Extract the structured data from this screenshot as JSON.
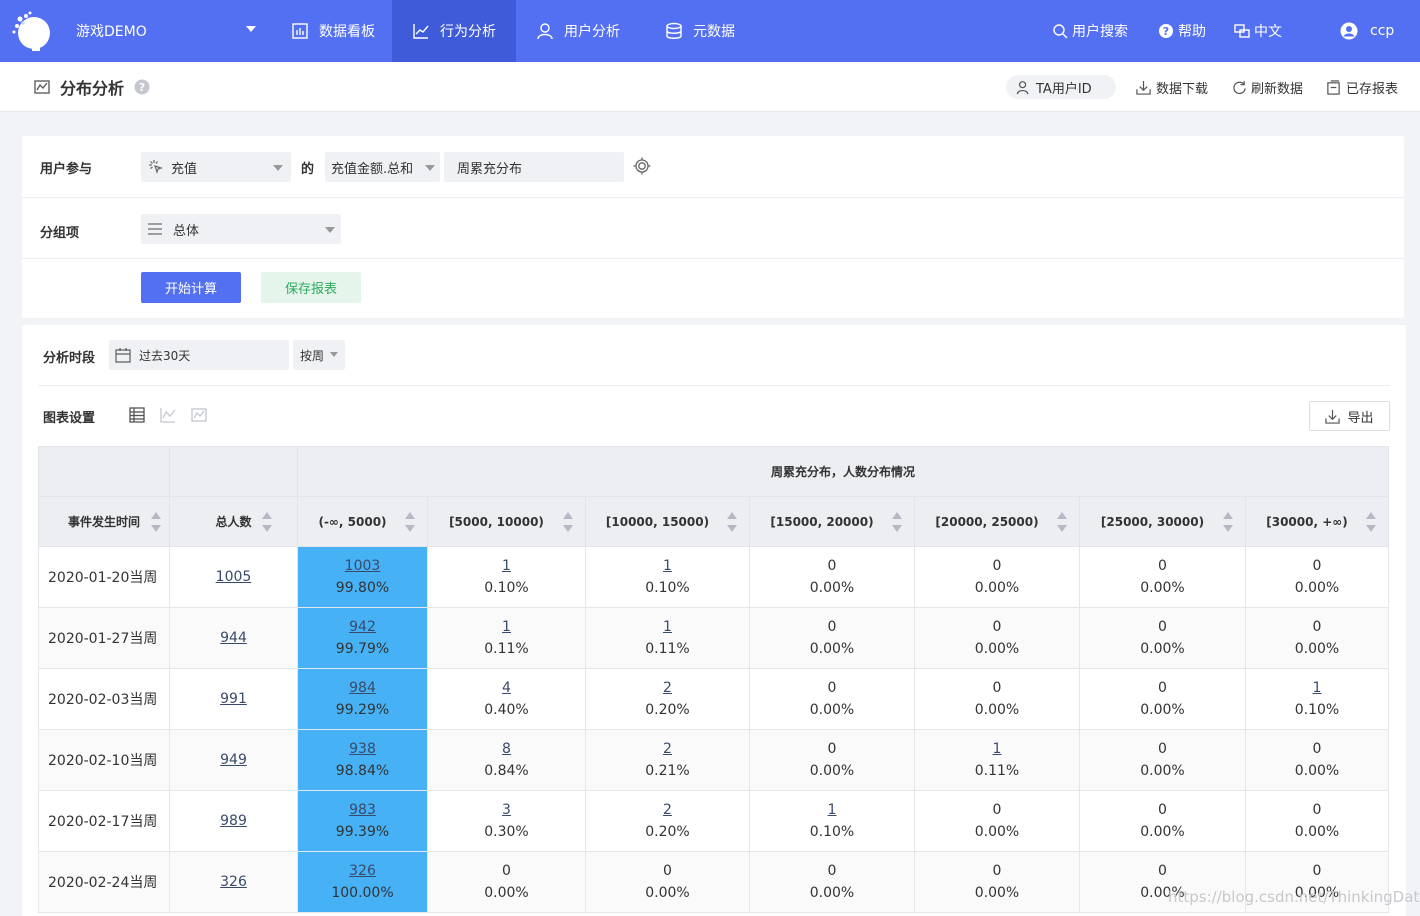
{
  "topnav": {
    "project": "游戏DEMO",
    "tabs": [
      {
        "label": "数据看板",
        "icon": "bar-chart-icon"
      },
      {
        "label": "行为分析",
        "icon": "line-chart-icon"
      },
      {
        "label": "用户分析",
        "icon": "user-icon"
      },
      {
        "label": "元数据",
        "icon": "database-icon"
      }
    ],
    "active_tab": "行为分析",
    "right": [
      {
        "label": "用户搜索",
        "icon": "search-icon"
      },
      {
        "label": "帮助",
        "icon": "help-icon"
      },
      {
        "label": "中文",
        "icon": "language-icon"
      },
      {
        "label": "ccp",
        "icon": "avatar-icon"
      }
    ],
    "colors": {
      "bar": "#5470f2",
      "active": "#3f5bd9"
    }
  },
  "subheader": {
    "title": "分布分析",
    "actions": [
      "TA用户ID",
      "数据下载",
      "刷新数据",
      "已存报表"
    ]
  },
  "query": {
    "participation_label": "用户参与",
    "event": "充值",
    "of_label": "的",
    "metric": "充值金额.总和",
    "distribution": "周累充分布",
    "group_label": "分组项",
    "group_value": "总体",
    "calc_button": "开始计算",
    "save_button": "保存报表"
  },
  "analysis": {
    "period_label": "分析时段",
    "period_value": "过去30天",
    "granularity": "按周",
    "chart_settings_label": "图表设置",
    "export_button": "导出"
  },
  "table": {
    "group_header": "周累充分布，人数分布情况",
    "col_date": "事件发生时间",
    "col_total": "总人数",
    "buckets": [
      "(-∞, 5000)",
      "[5000, 10000)",
      "[10000, 15000)",
      "[15000, 20000)",
      "[20000, 25000)",
      "[25000, 30000)",
      "[30000, +∞)"
    ],
    "highlight_color": "#47b1f5",
    "rows": [
      {
        "date": "2020-01-20当周",
        "total": "1005",
        "cells": [
          {
            "c": "1003",
            "p": "99.80%"
          },
          {
            "c": "1",
            "p": "0.10%"
          },
          {
            "c": "1",
            "p": "0.10%"
          },
          {
            "c": "0",
            "p": "0.00%"
          },
          {
            "c": "0",
            "p": "0.00%"
          },
          {
            "c": "0",
            "p": "0.00%"
          },
          {
            "c": "0",
            "p": "0.00%"
          }
        ]
      },
      {
        "date": "2020-01-27当周",
        "total": "944",
        "cells": [
          {
            "c": "942",
            "p": "99.79%"
          },
          {
            "c": "1",
            "p": "0.11%"
          },
          {
            "c": "1",
            "p": "0.11%"
          },
          {
            "c": "0",
            "p": "0.00%"
          },
          {
            "c": "0",
            "p": "0.00%"
          },
          {
            "c": "0",
            "p": "0.00%"
          },
          {
            "c": "0",
            "p": "0.00%"
          }
        ]
      },
      {
        "date": "2020-02-03当周",
        "total": "991",
        "cells": [
          {
            "c": "984",
            "p": "99.29%"
          },
          {
            "c": "4",
            "p": "0.40%"
          },
          {
            "c": "2",
            "p": "0.20%"
          },
          {
            "c": "0",
            "p": "0.00%"
          },
          {
            "c": "0",
            "p": "0.00%"
          },
          {
            "c": "0",
            "p": "0.00%"
          },
          {
            "c": "1",
            "p": "0.10%"
          }
        ]
      },
      {
        "date": "2020-02-10当周",
        "total": "949",
        "cells": [
          {
            "c": "938",
            "p": "98.84%"
          },
          {
            "c": "8",
            "p": "0.84%"
          },
          {
            "c": "2",
            "p": "0.21%"
          },
          {
            "c": "0",
            "p": "0.00%"
          },
          {
            "c": "1",
            "p": "0.11%"
          },
          {
            "c": "0",
            "p": "0.00%"
          },
          {
            "c": "0",
            "p": "0.00%"
          }
        ]
      },
      {
        "date": "2020-02-17当周",
        "total": "989",
        "cells": [
          {
            "c": "983",
            "p": "99.39%"
          },
          {
            "c": "3",
            "p": "0.30%"
          },
          {
            "c": "2",
            "p": "0.20%"
          },
          {
            "c": "1",
            "p": "0.10%"
          },
          {
            "c": "0",
            "p": "0.00%"
          },
          {
            "c": "0",
            "p": "0.00%"
          },
          {
            "c": "0",
            "p": "0.00%"
          }
        ]
      },
      {
        "date": "2020-02-24当周",
        "total": "326",
        "cells": [
          {
            "c": "326",
            "p": "100.00%"
          },
          {
            "c": "0",
            "p": "0.00%"
          },
          {
            "c": "0",
            "p": "0.00%"
          },
          {
            "c": "0",
            "p": "0.00%"
          },
          {
            "c": "0",
            "p": "0.00%"
          },
          {
            "c": "0",
            "p": "0.00%"
          },
          {
            "c": "0",
            "p": "0.00%"
          }
        ]
      }
    ]
  },
  "watermark": "https://blog.csdn.net/ThinkingData"
}
